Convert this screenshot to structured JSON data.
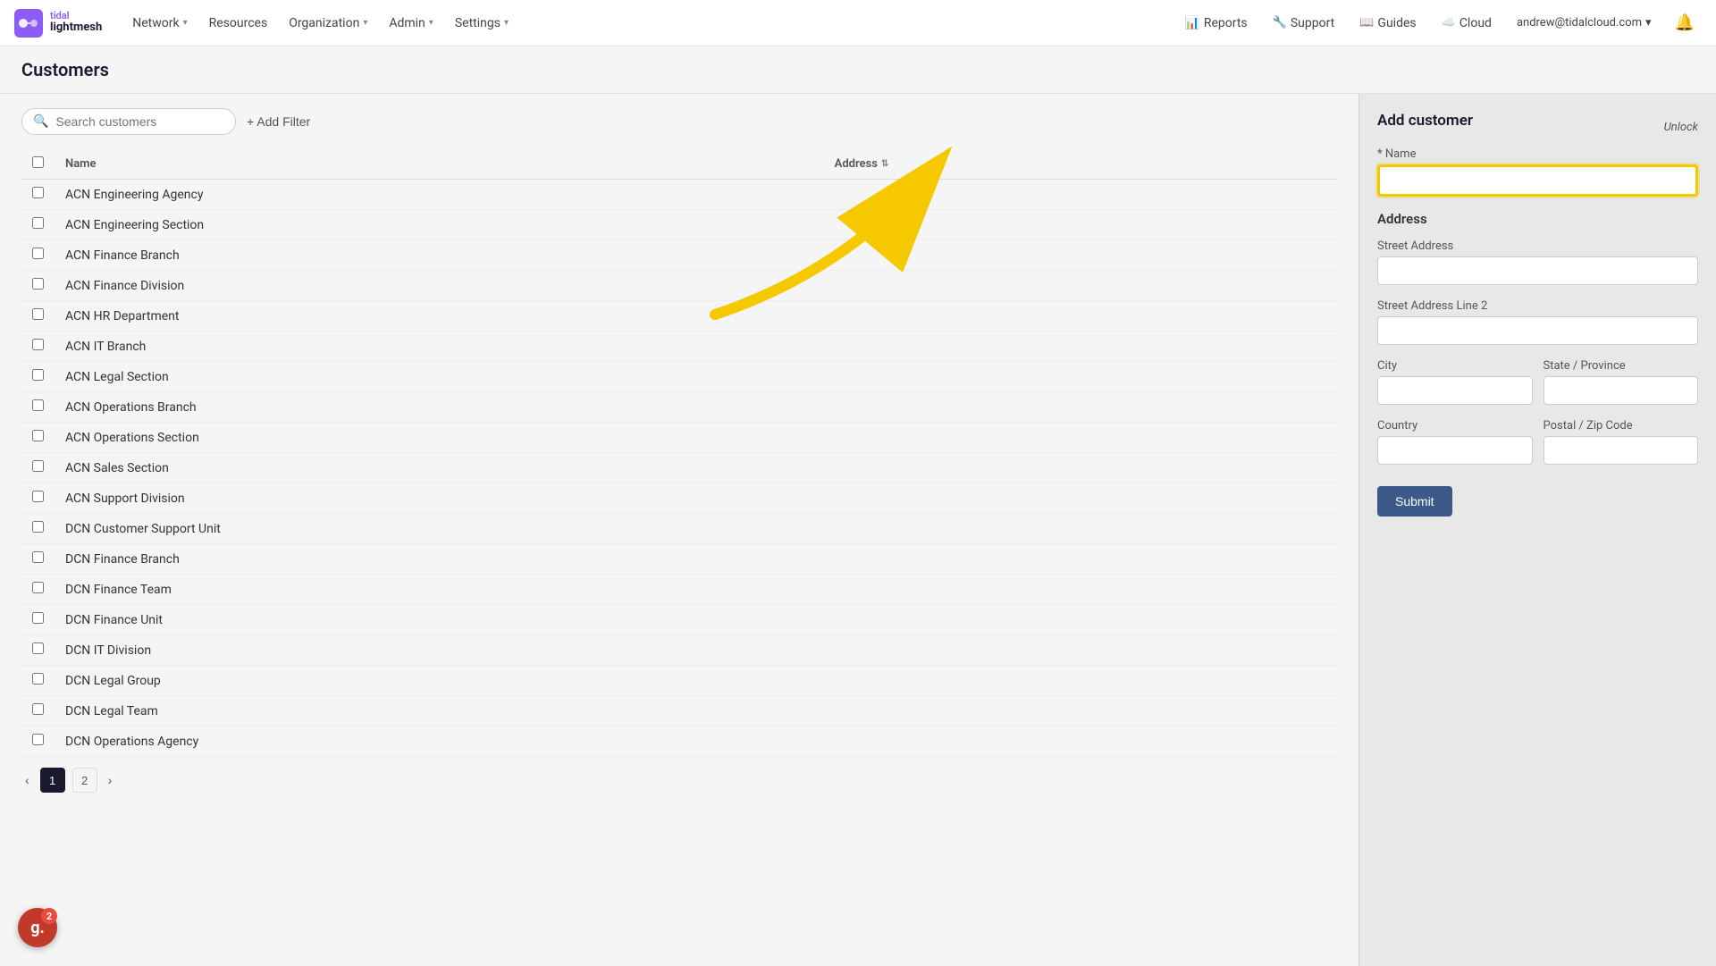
{
  "logo": {
    "brand_top": "tidal",
    "brand_bottom": "lightmesh",
    "icon_color": "#8b5cf6"
  },
  "nav": {
    "items": [
      {
        "label": "Network",
        "has_dropdown": true
      },
      {
        "label": "Resources",
        "has_dropdown": false
      },
      {
        "label": "Organization",
        "has_dropdown": true
      },
      {
        "label": "Admin",
        "has_dropdown": true
      },
      {
        "label": "Settings",
        "has_dropdown": true
      }
    ],
    "right_items": [
      {
        "label": "Reports",
        "icon": "chart-icon"
      },
      {
        "label": "Support",
        "icon": "wrench-icon"
      },
      {
        "label": "Guides",
        "icon": "book-icon"
      },
      {
        "label": "Cloud",
        "icon": "cloud-icon"
      }
    ],
    "user_email": "andrew@tidalcloud.com"
  },
  "page": {
    "title": "Customers"
  },
  "toolbar": {
    "search_placeholder": "Search customers",
    "add_filter_label": "+ Add Filter"
  },
  "table": {
    "columns": [
      "Name",
      "Address"
    ],
    "rows": [
      {
        "name": "ACN Engineering Agency",
        "address": ""
      },
      {
        "name": "ACN Engineering Section",
        "address": ""
      },
      {
        "name": "ACN Finance Branch",
        "address": ""
      },
      {
        "name": "ACN Finance Division",
        "address": ""
      },
      {
        "name": "ACN HR Department",
        "address": ""
      },
      {
        "name": "ACN IT Branch",
        "address": ""
      },
      {
        "name": "ACN Legal Section",
        "address": ""
      },
      {
        "name": "ACN Operations Branch",
        "address": ""
      },
      {
        "name": "ACN Operations Section",
        "address": ""
      },
      {
        "name": "ACN Sales Section",
        "address": ""
      },
      {
        "name": "ACN Support Division",
        "address": ""
      },
      {
        "name": "DCN Customer Support Unit",
        "address": ""
      },
      {
        "name": "DCN Finance Branch",
        "address": ""
      },
      {
        "name": "DCN Finance Team",
        "address": ""
      },
      {
        "name": "DCN Finance Unit",
        "address": ""
      },
      {
        "name": "DCN IT Division",
        "address": ""
      },
      {
        "name": "DCN Legal Group",
        "address": ""
      },
      {
        "name": "DCN Legal Team",
        "address": ""
      },
      {
        "name": "DCN Operations Agency",
        "address": ""
      }
    ]
  },
  "pagination": {
    "prev_label": "‹",
    "next_label": "›",
    "current_page": 1,
    "pages": [
      1,
      2
    ]
  },
  "add_customer_panel": {
    "title": "Add customer",
    "unlock_label": "Unlock",
    "form": {
      "name_label": "* Name",
      "name_placeholder": "",
      "address_section": "Address",
      "street_address_label": "Street Address",
      "street_address_2_label": "Street Address Line 2",
      "city_label": "City",
      "state_label": "State / Province",
      "country_label": "Country",
      "postal_label": "Postal / Zip Code",
      "submit_label": "Submit"
    }
  },
  "grader": {
    "letter": "g.",
    "badge_count": "2"
  }
}
